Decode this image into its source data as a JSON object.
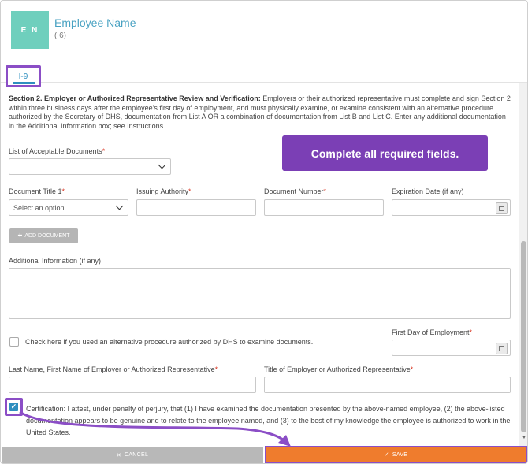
{
  "header": {
    "avatar_initials": "E N",
    "employee_name": "Employee Name",
    "employee_sub": "( 6)"
  },
  "tabs": [
    {
      "label": "I-9",
      "active": true
    }
  ],
  "section2": {
    "title": "Section 2. Employer or Authorized Representative Review and Verification:",
    "body": " Employers or their authorized representative must complete and sign Section 2 within three business days after the employee's first day of employment, and must physically examine, or examine consistent with an alternative procedure authorized by the Secretary of DHS, documentation from List A OR a combination of documentation from List B and List C. Enter any additional documentation in the Additional Information box; see Instructions."
  },
  "tooltip": {
    "text": "Complete all required fields.",
    "color": "#7b3fb5"
  },
  "list_of_docs": {
    "label": "List of Acceptable Documents",
    "required_mark": "*",
    "value": ""
  },
  "document_row": {
    "doc_title": {
      "label": "Document Title 1",
      "required_mark": "*",
      "placeholder": "Select an option"
    },
    "issuing_authority": {
      "label": "Issuing Authority",
      "required_mark": "*",
      "value": ""
    },
    "document_number": {
      "label": "Document Number",
      "required_mark": "*",
      "value": ""
    },
    "expiration_date": {
      "label": "Expiration Date (if any)",
      "value": ""
    }
  },
  "add_document": {
    "label": "ADD DOCUMENT",
    "icon": "plus-icon"
  },
  "additional_info": {
    "label": "Additional Information (if any)",
    "value": ""
  },
  "alt_procedure": {
    "label": "Check here if you used an alternative procedure authorized by DHS to examine documents.",
    "checked": false
  },
  "first_day": {
    "label": "First Day of Employment",
    "required_mark": "*",
    "value": ""
  },
  "employer_name": {
    "label": "Last Name, First Name of Employer or Authorized Representative",
    "required_mark": "*",
    "value": ""
  },
  "employer_title": {
    "label": "Title of Employer or Authorized Representative",
    "required_mark": "*",
    "value": ""
  },
  "certification": {
    "checked": true,
    "text": "Certification: I attest, under penalty of perjury, that (1) I have examined the documentation presented by the above-named employee, (2) the above-listed documentation appears to be genuine and to relate to the employee named, and (3) to the best of my knowledge the employee is authorized to work in the United States."
  },
  "footer": {
    "cancel_label": "CANCEL",
    "save_label": "SAVE"
  },
  "colors": {
    "accent": "#2f8fbf",
    "highlight": "#8b4ec6",
    "save": "#ef7c2d",
    "required": "#d9331f"
  }
}
